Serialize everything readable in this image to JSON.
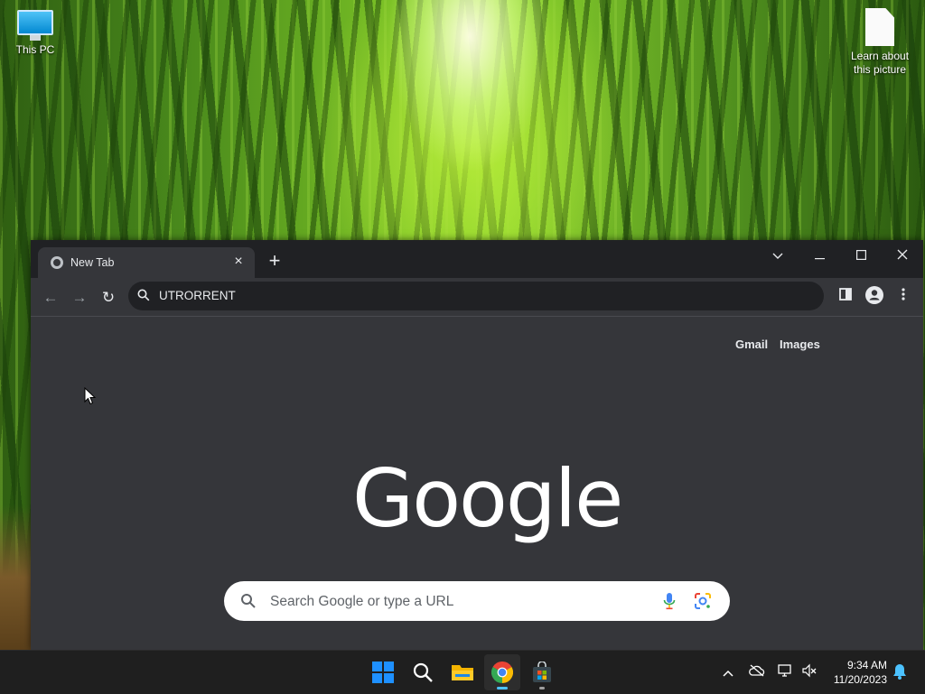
{
  "desktop": {
    "icons": [
      {
        "label": "This PC"
      },
      {
        "label_line1": "Learn about",
        "label_line2": "this picture"
      }
    ]
  },
  "browser": {
    "tab": {
      "title": "New Tab",
      "close_glyph": "×"
    },
    "new_tab_glyph": "+",
    "window_controls": {
      "tab_search": "⌄",
      "minimize": "—",
      "maximize": "☐",
      "close": "✕"
    },
    "nav": {
      "back": "←",
      "forward": "→",
      "reload": "↻"
    },
    "omnibox": {
      "value": "UTRORRENT"
    },
    "toolbar_icons": [
      "side-panel-icon",
      "profile-icon",
      "menu-icon"
    ],
    "page": {
      "top_links": [
        "Gmail",
        "Images"
      ],
      "logo_text": "Google",
      "search_placeholder": "Search Google or type a URL"
    }
  },
  "taskbar": {
    "apps": [
      "start-icon",
      "search-icon",
      "file-explorer-icon",
      "chrome-icon",
      "microsoft-store-icon"
    ],
    "active_app": "chrome-icon",
    "tray": {
      "chevron": "^"
    },
    "clock": {
      "time": "9:34 AM",
      "date": "11/20/2023"
    }
  },
  "colors": {
    "window_bg": "#35363a",
    "titlebar_bg": "#202124",
    "taskbar_bg": "#1f1f1f",
    "accent": "#4cc2ff"
  }
}
